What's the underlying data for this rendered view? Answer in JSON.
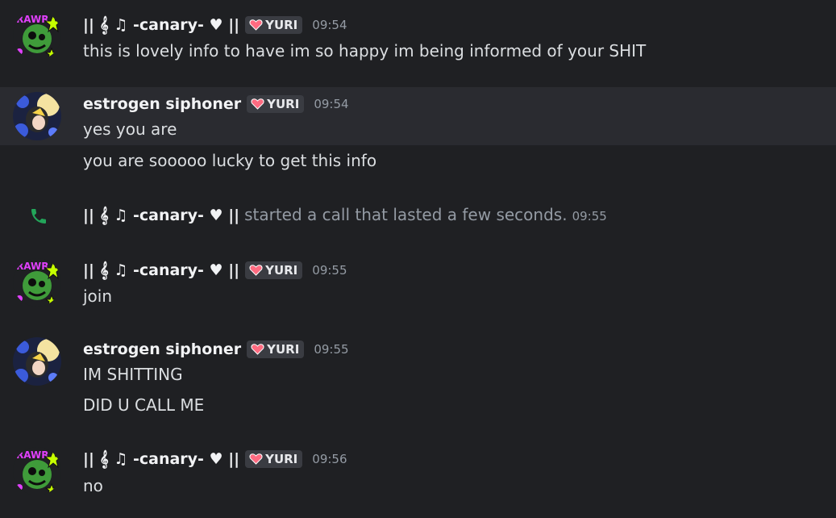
{
  "users": {
    "canary": {
      "name": "|| 𝄞 ♫ -canary- ♥ ||",
      "avatar_icon": "green-monster-avatar",
      "accent": "#d946ef"
    },
    "estrogen": {
      "name": "estrogen siphoner",
      "avatar_icon": "anime-moon-avatar",
      "accent": "#3b5bdb"
    }
  },
  "role_tag": {
    "label": "YURI",
    "icon": "heart-icon",
    "color": "#ff6b81"
  },
  "messages": [
    {
      "user": "|| 𝄞 ♫ -canary- ♥ ||",
      "time": "09:54",
      "lines": [
        "this is lovely info to have im so happy im being informed of your SHIT"
      ]
    },
    {
      "user": "estrogen siphoner",
      "time": "09:54",
      "lines": [
        "yes you are",
        "you are sooooo lucky to get this info"
      ]
    },
    {
      "user": "|| 𝄞 ♫ -canary- ♥ ||",
      "time": "09:55",
      "lines": [
        "join"
      ]
    },
    {
      "user": "estrogen siphoner",
      "time": "09:55",
      "lines": [
        "IM SHITTING",
        "DID U CALL ME"
      ]
    },
    {
      "user": "|| 𝄞 ♫ -canary- ♥ ||",
      "time": "09:56",
      "lines": [
        "no"
      ]
    }
  ],
  "call": {
    "user": "|| 𝄞 ♫ -canary- ♥ ||",
    "text": "started a call that lasted a few seconds.",
    "time": "09:55",
    "icon": "phone-icon",
    "icon_color": "#23a55a"
  }
}
